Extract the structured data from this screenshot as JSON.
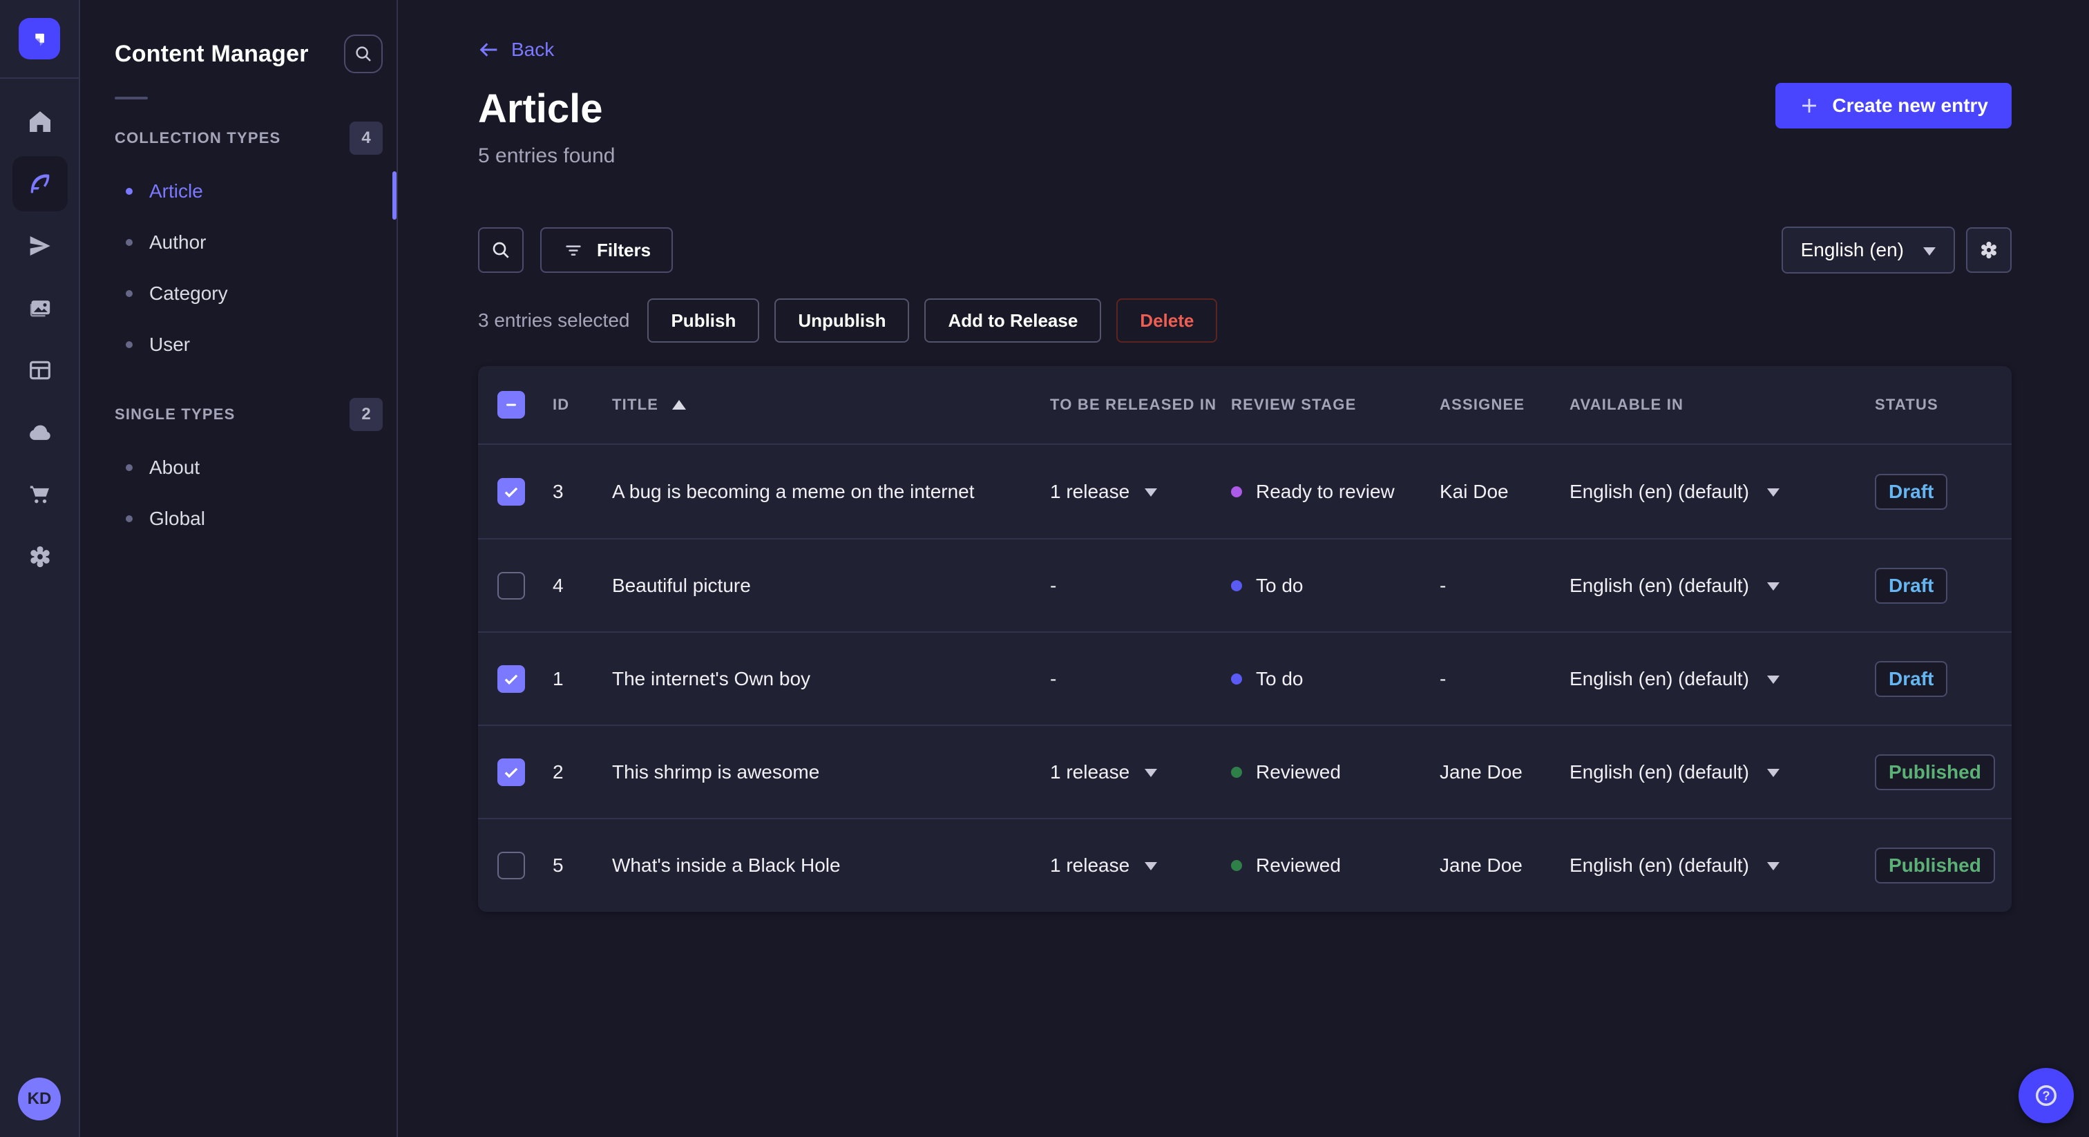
{
  "nav": {
    "logo_icon": "strapi-logo",
    "items": [
      "home",
      "content-manager",
      "releases",
      "media-library",
      "content-type-builder",
      "cloud",
      "marketplace",
      "settings"
    ],
    "avatar_initials": "KD"
  },
  "subnav": {
    "title": "Content Manager",
    "sections": [
      {
        "label": "COLLECTION TYPES",
        "count": "4",
        "items": [
          {
            "label": "Article"
          },
          {
            "label": "Author"
          },
          {
            "label": "Category"
          },
          {
            "label": "User"
          }
        ]
      },
      {
        "label": "SINGLE TYPES",
        "count": "2",
        "items": [
          {
            "label": "About"
          },
          {
            "label": "Global"
          }
        ]
      }
    ]
  },
  "header": {
    "back": "Back",
    "title": "Article",
    "subtitle": "5 entries found",
    "create": "Create new entry"
  },
  "toolbar": {
    "filters": "Filters",
    "locale": "English (en)"
  },
  "selection": {
    "label": "3 entries selected",
    "publish": "Publish",
    "unpublish": "Unpublish",
    "add_to_release": "Add to Release",
    "delete": "Delete"
  },
  "table": {
    "columns": [
      "ID",
      "TITLE",
      "TO BE RELEASED IN",
      "REVIEW STAGE",
      "ASSIGNEE",
      "AVAILABLE IN",
      "STATUS"
    ],
    "rows": [
      {
        "checked": true,
        "id": "3",
        "title": "A bug is becoming a meme on the internet",
        "release": "1 release",
        "stage": "Ready to review",
        "assignee": "Kai Doe",
        "locale": "English (en) (default)",
        "status": "Draft"
      },
      {
        "checked": false,
        "id": "4",
        "title": "Beautiful picture",
        "release": "-",
        "stage": "To do",
        "assignee": "-",
        "locale": "English (en) (default)",
        "status": "Draft"
      },
      {
        "checked": true,
        "id": "1",
        "title": "The internet's Own boy",
        "release": "-",
        "stage": "To do",
        "assignee": "-",
        "locale": "English (en) (default)",
        "status": "Draft"
      },
      {
        "checked": true,
        "id": "2",
        "title": "This shrimp is awesome",
        "release": "1 release",
        "stage": "Reviewed",
        "assignee": "Jane Doe",
        "locale": "English (en) (default)",
        "status": "Published"
      },
      {
        "checked": false,
        "id": "5",
        "title": "What's inside a Black Hole",
        "release": "1 release",
        "stage": "Reviewed",
        "assignee": "Jane Doe",
        "locale": "English (en) (default)",
        "status": "Published"
      }
    ]
  },
  "colors": {
    "primary": "#4945ff",
    "primary_light": "#7b79ff",
    "page_bg": "#181826",
    "card_bg": "#212134",
    "border": "#32324d",
    "text_muted": "#a5a5ba",
    "draft": "#66b7f1",
    "published": "#5cb176",
    "danger": "#ee5e52",
    "stage_todo": "#5a5af5",
    "stage_ready": "#ac5ae8",
    "stage_reviewed": "#2f8048"
  }
}
